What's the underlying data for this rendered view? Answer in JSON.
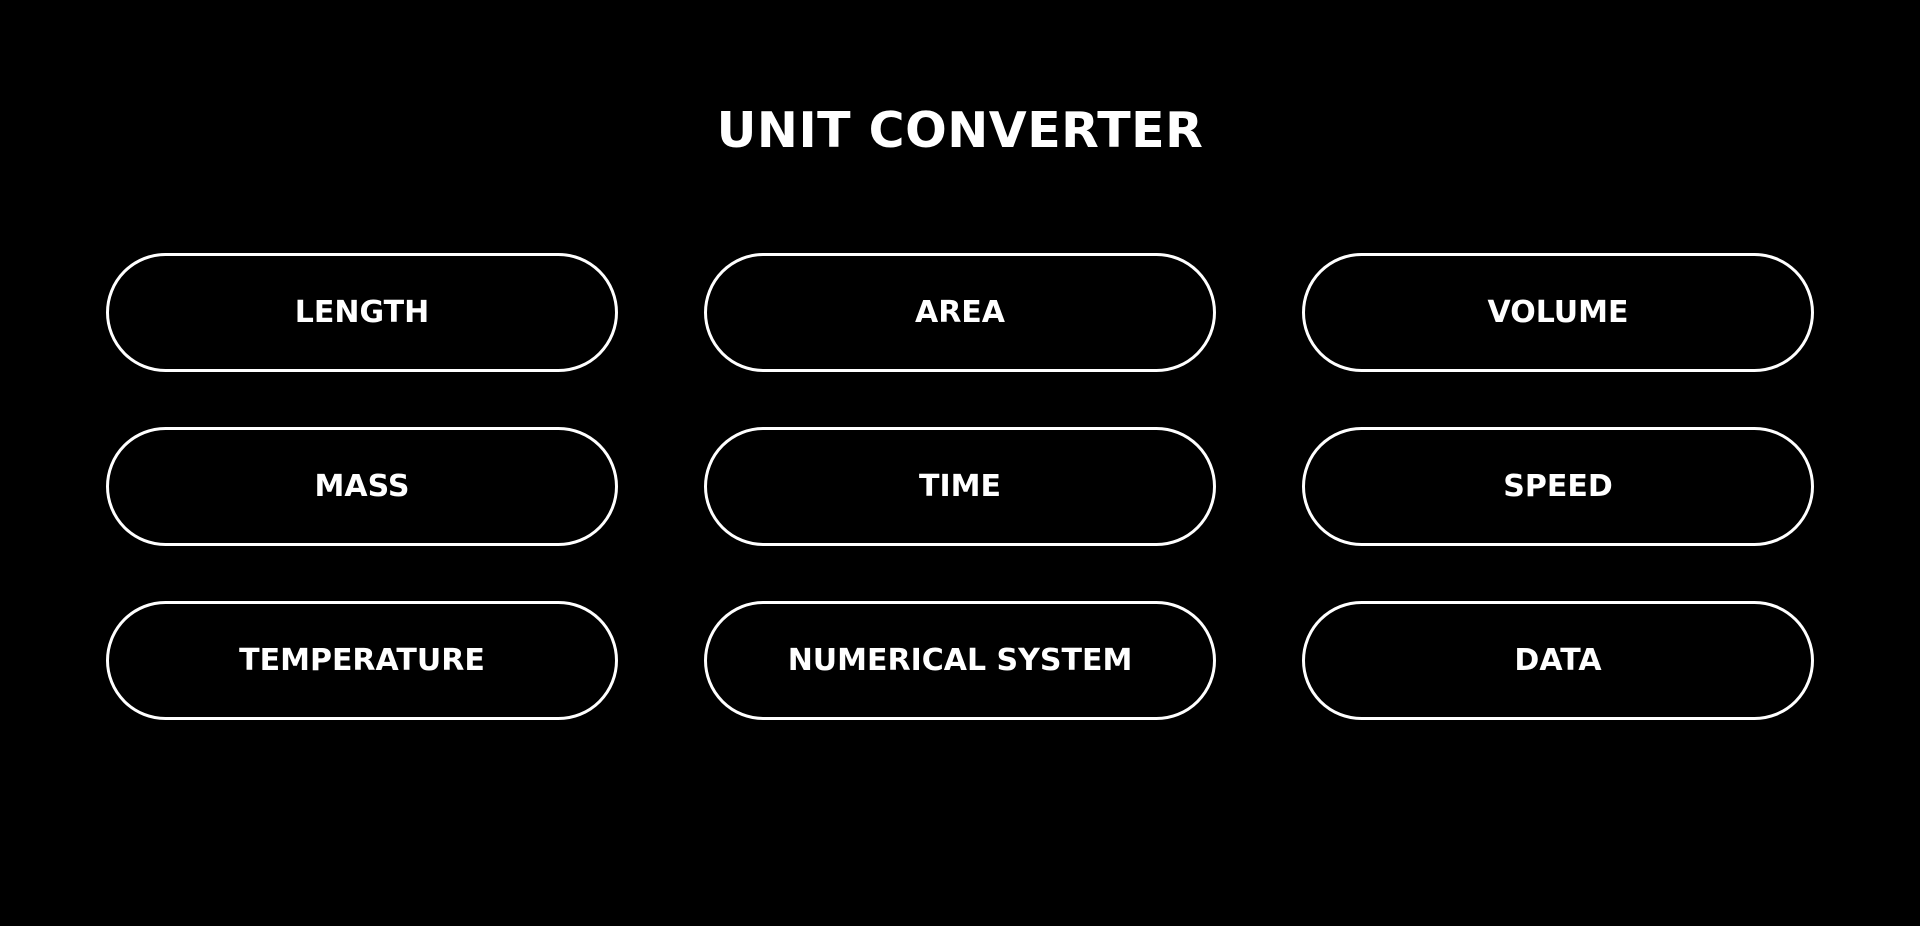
{
  "header": {
    "title": "UNIT CONVERTER"
  },
  "categories": [
    {
      "label": "LENGTH"
    },
    {
      "label": "AREA"
    },
    {
      "label": "VOLUME"
    },
    {
      "label": "MASS"
    },
    {
      "label": "TIME"
    },
    {
      "label": "SPEED"
    },
    {
      "label": "TEMPERATURE"
    },
    {
      "label": "NUMERICAL SYSTEM"
    },
    {
      "label": "DATA"
    }
  ],
  "colors": {
    "background": "#000000",
    "foreground": "#ffffff"
  }
}
